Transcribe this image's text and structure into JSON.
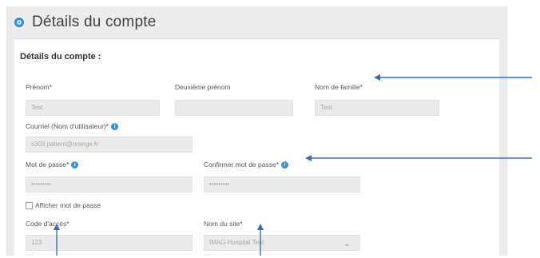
{
  "panel": {
    "title": "Détails du compte",
    "section_title": "Détails du compte :"
  },
  "fields": {
    "first_name": {
      "label": "Prénom*",
      "value": "Test"
    },
    "middle_name": {
      "label": "Deuxième prénom",
      "value": ""
    },
    "last_name": {
      "label": "Nom de famille*",
      "value": "Test"
    },
    "email": {
      "label": "Courriel (Nom d'utilisateur)*",
      "value": "s303 patient@orange.fr"
    },
    "password": {
      "label": "Mot de passe*",
      "value": "•••••••••"
    },
    "confirm_password": {
      "label": "Confirmer mot de passe*",
      "value": "•••••••••"
    },
    "show_password": {
      "label": "Afficher mot de passe"
    },
    "access_code": {
      "label": "Code d'accès*",
      "value": "123"
    },
    "site_name": {
      "label": "Nom du site*",
      "value": "IMAG Hospital Test"
    }
  },
  "icons": {
    "header_bullet": "circle-bullet-icon",
    "info": "info-icon",
    "dropdown": "chevron-down-icon",
    "annotation": "arrow-annotation"
  },
  "colors": {
    "accent": "#2e8fd6",
    "arrow": "#3b6db5",
    "field_bg": "#ebebeb"
  }
}
